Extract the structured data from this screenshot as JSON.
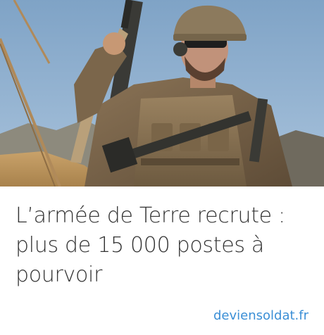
{
  "ad": {
    "headline": "L’armée de Terre recrute : plus de 15 000 postes à pourvoir",
    "source": "deviensoldat.fr",
    "image_subject": "soldier-photo",
    "link_color": "#3b8fd6",
    "text_color": "#333333"
  }
}
